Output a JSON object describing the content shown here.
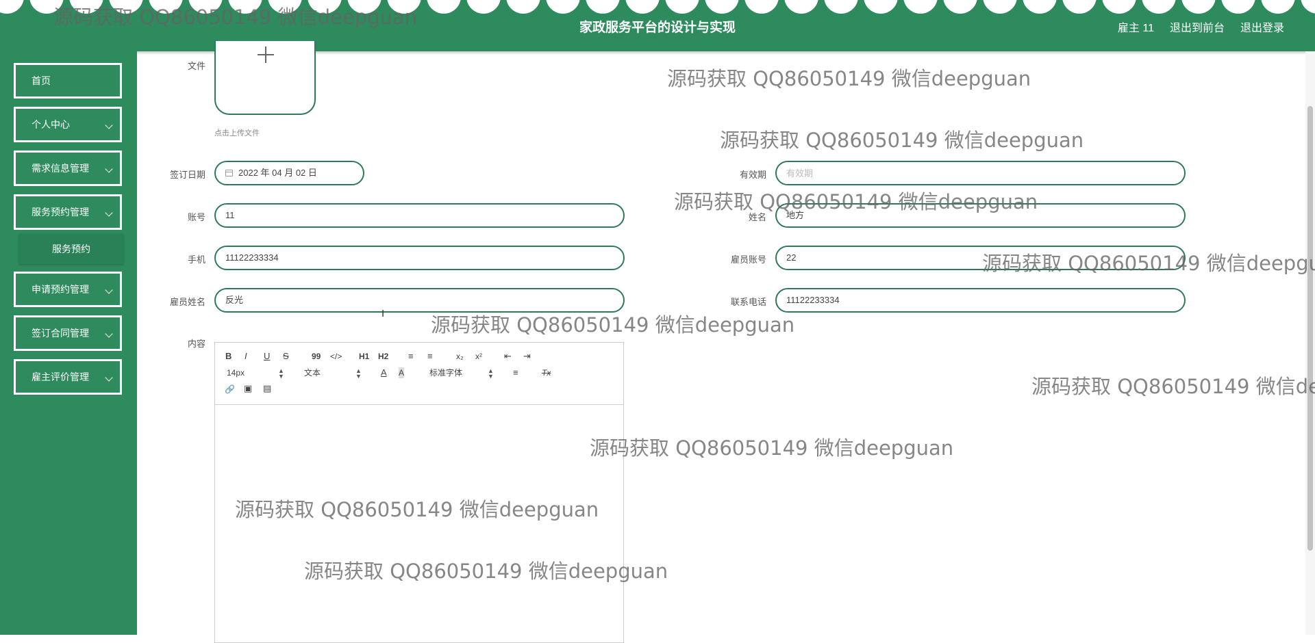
{
  "header": {
    "title": "家政服务平台的设计与实现",
    "user": "雇主 11",
    "link_front": "退出到前台",
    "link_logout": "退出登录"
  },
  "sidebar": {
    "items": [
      {
        "label": "首页"
      },
      {
        "label": "个人中心"
      },
      {
        "label": "需求信息管理"
      },
      {
        "label": "服务预约管理"
      },
      {
        "label": "申请预约管理"
      },
      {
        "label": "签订合同管理"
      },
      {
        "label": "雇主评价管理"
      }
    ],
    "sub_item": "服务预约"
  },
  "form": {
    "file_label": "文件",
    "upload_tip": "点击上传文件",
    "sign_date_label": "签订日期",
    "sign_date_value": "2022 年 04 月 02 日",
    "validity_label": "有效期",
    "validity_placeholder": "有效期",
    "account_label": "账号",
    "account_value": "11",
    "name_label": "姓名",
    "name_value": "地方",
    "phone_label": "手机",
    "phone_value": "11122233334",
    "employee_account_label": "雇员账号",
    "employee_account_value": "22",
    "employee_name_label": "雇员姓名",
    "employee_name_value": "反光",
    "contact_label": "联系电话",
    "contact_value": "11122233334",
    "content_label": "内容"
  },
  "editor": {
    "bold": "B",
    "italic": "I",
    "underline": "U",
    "strike": "S",
    "quote": "99",
    "code": "</>",
    "h1": "H1",
    "h2": "H2",
    "ordered": "≡",
    "bullet": "≡",
    "sub": "x₂",
    "sup": "x²",
    "outdent": "⇤",
    "indent": "⇥",
    "font_size": "14px",
    "text_type": "文本",
    "font_color": "A",
    "bg_color": "A",
    "font_family": "标准字体",
    "align": "≡",
    "clear": "Tx",
    "link": "🔗",
    "image": "▣",
    "video": "▤"
  },
  "watermark": "源码获取 QQ86050149 微信deepguan"
}
